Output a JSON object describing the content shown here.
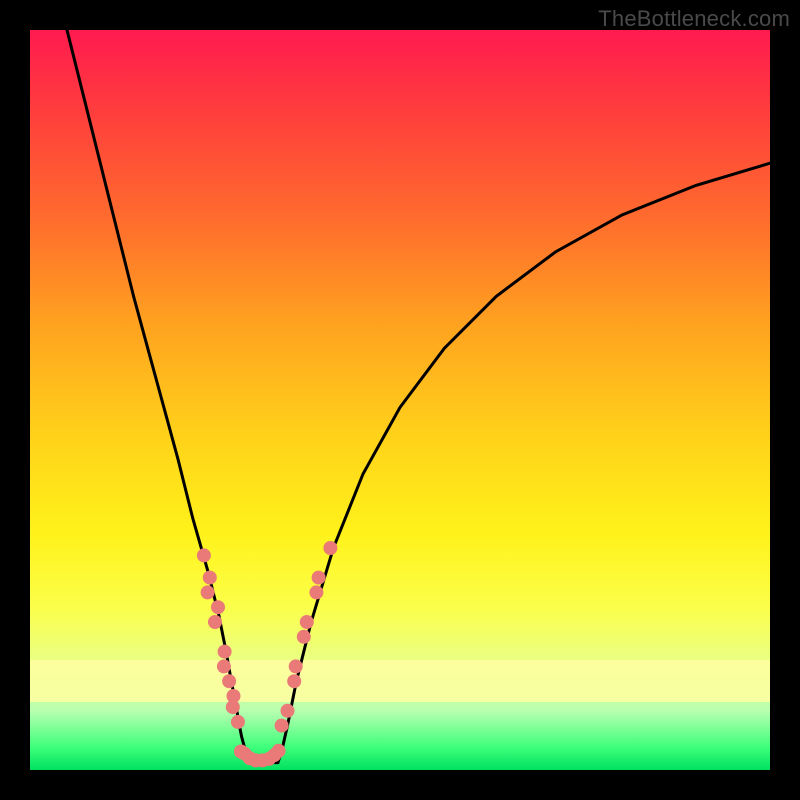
{
  "watermark": {
    "text": "TheBottleneck.com"
  },
  "chart_data": {
    "type": "line",
    "title": "",
    "xlabel": "",
    "ylabel": "",
    "xlim": [
      0,
      100
    ],
    "ylim": [
      0,
      100
    ],
    "series": [
      {
        "name": "left-curve",
        "x": [
          5,
          8,
          11,
          14,
          17,
          20,
          22,
          24,
          25.5,
          26.5,
          27.2,
          27.8,
          28.2,
          28.6,
          29,
          29.3,
          29.5
        ],
        "y": [
          100,
          88,
          76,
          64,
          53,
          42,
          34,
          27,
          21,
          16,
          12,
          9,
          6.5,
          4.5,
          3,
          1.8,
          1
        ]
      },
      {
        "name": "right-curve",
        "x": [
          33.5,
          34,
          34.8,
          36,
          38,
          41,
          45,
          50,
          56,
          63,
          71,
          80,
          90,
          100
        ],
        "y": [
          1,
          2.5,
          6,
          12,
          20,
          30,
          40,
          49,
          57,
          64,
          70,
          75,
          79,
          82
        ]
      },
      {
        "name": "floor",
        "x": [
          29.5,
          33.5
        ],
        "y": [
          1,
          1
        ]
      }
    ],
    "scatter": [
      {
        "name": "left-cluster",
        "color": "#e97a78",
        "points": [
          {
            "x": 23.5,
            "y": 29
          },
          {
            "x": 24.3,
            "y": 26
          },
          {
            "x": 24.0,
            "y": 24
          },
          {
            "x": 25.4,
            "y": 22
          },
          {
            "x": 25.0,
            "y": 20
          },
          {
            "x": 26.3,
            "y": 16
          },
          {
            "x": 26.2,
            "y": 14
          },
          {
            "x": 26.9,
            "y": 12
          },
          {
            "x": 27.5,
            "y": 10
          },
          {
            "x": 27.4,
            "y": 8.5
          },
          {
            "x": 28.1,
            "y": 6.5
          }
        ]
      },
      {
        "name": "right-cluster",
        "color": "#e97a78",
        "points": [
          {
            "x": 34.0,
            "y": 6
          },
          {
            "x": 34.8,
            "y": 8
          },
          {
            "x": 35.7,
            "y": 12
          },
          {
            "x": 35.9,
            "y": 14
          },
          {
            "x": 37.0,
            "y": 18
          },
          {
            "x": 37.4,
            "y": 20
          },
          {
            "x": 38.7,
            "y": 24
          },
          {
            "x": 39.0,
            "y": 26
          },
          {
            "x": 40.6,
            "y": 30
          }
        ]
      },
      {
        "name": "bottom-cluster",
        "color": "#e97a78",
        "points": [
          {
            "x": 28.5,
            "y": 2.5
          },
          {
            "x": 29.0,
            "y": 2.2
          },
          {
            "x": 29.7,
            "y": 1.6
          },
          {
            "x": 30.5,
            "y": 1.3
          },
          {
            "x": 31.4,
            "y": 1.3
          },
          {
            "x": 32.3,
            "y": 1.5
          },
          {
            "x": 33.0,
            "y": 2.0
          },
          {
            "x": 33.6,
            "y": 2.6
          }
        ]
      }
    ]
  }
}
